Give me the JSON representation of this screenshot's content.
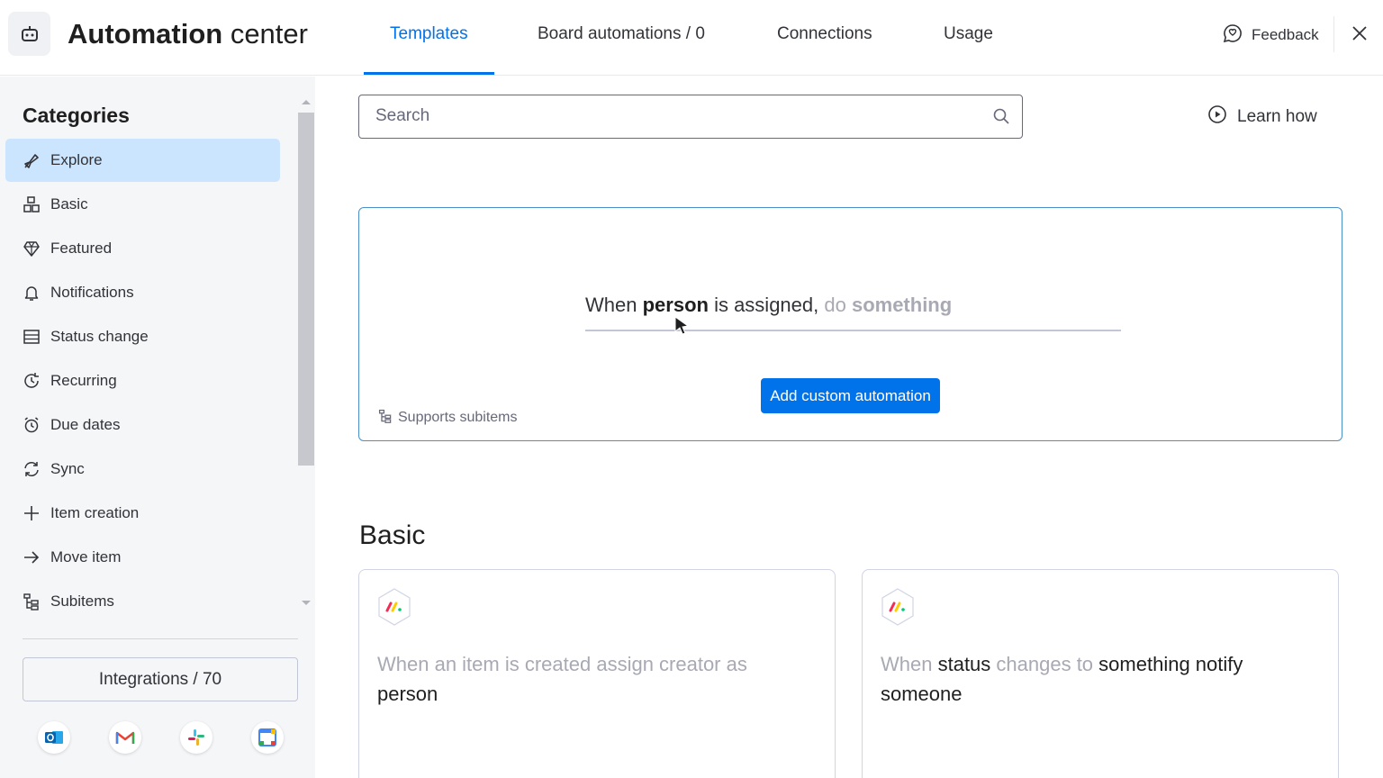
{
  "header": {
    "title_bold": "Automation",
    "title_light": " center",
    "tabs": [
      {
        "label": "Templates",
        "active": true
      },
      {
        "label": "Board automations / 0",
        "active": false
      },
      {
        "label": "Connections",
        "active": false
      },
      {
        "label": "Usage",
        "active": false
      }
    ],
    "feedback_label": "Feedback",
    "accent_color": "#0073ea"
  },
  "sidebar": {
    "title": "Categories",
    "items": [
      {
        "label": "Explore",
        "icon": "explore-icon",
        "selected": true
      },
      {
        "label": "Basic",
        "icon": "basic-icon",
        "selected": false
      },
      {
        "label": "Featured",
        "icon": "diamond-icon",
        "selected": false
      },
      {
        "label": "Notifications",
        "icon": "bell-icon",
        "selected": false
      },
      {
        "label": "Status change",
        "icon": "status-icon",
        "selected": false
      },
      {
        "label": "Recurring",
        "icon": "recurring-icon",
        "selected": false
      },
      {
        "label": "Due dates",
        "icon": "alarm-icon",
        "selected": false
      },
      {
        "label": "Sync",
        "icon": "sync-icon",
        "selected": false
      },
      {
        "label": "Item creation",
        "icon": "plus-icon",
        "selected": false
      },
      {
        "label": "Move item",
        "icon": "arrow-right-icon",
        "selected": false
      },
      {
        "label": "Subitems",
        "icon": "subitems-icon",
        "selected": false
      }
    ],
    "integrations_label": "Integrations / 70",
    "integration_icons": [
      "outlook-icon",
      "gmail-icon",
      "slack-icon",
      "google-calendar-icon"
    ]
  },
  "main": {
    "search": {
      "placeholder": "Search",
      "value": ""
    },
    "learn_how_label": "Learn how",
    "custom": {
      "when": "When ",
      "person": "person",
      "assigned": " is assigned,",
      "do": " do ",
      "something": "something",
      "button_label": "Add custom automation",
      "supports_label": "Supports subitems"
    },
    "section_title": "Basic",
    "templates": [
      {
        "part1": "When an item is created assign creator as ",
        "part2": "person",
        "part3": "",
        "part4": "",
        "part5": ""
      },
      {
        "part1": "When ",
        "part2": "status",
        "part3": " changes to ",
        "part4": "something",
        "part5": " notify someone"
      }
    ]
  }
}
